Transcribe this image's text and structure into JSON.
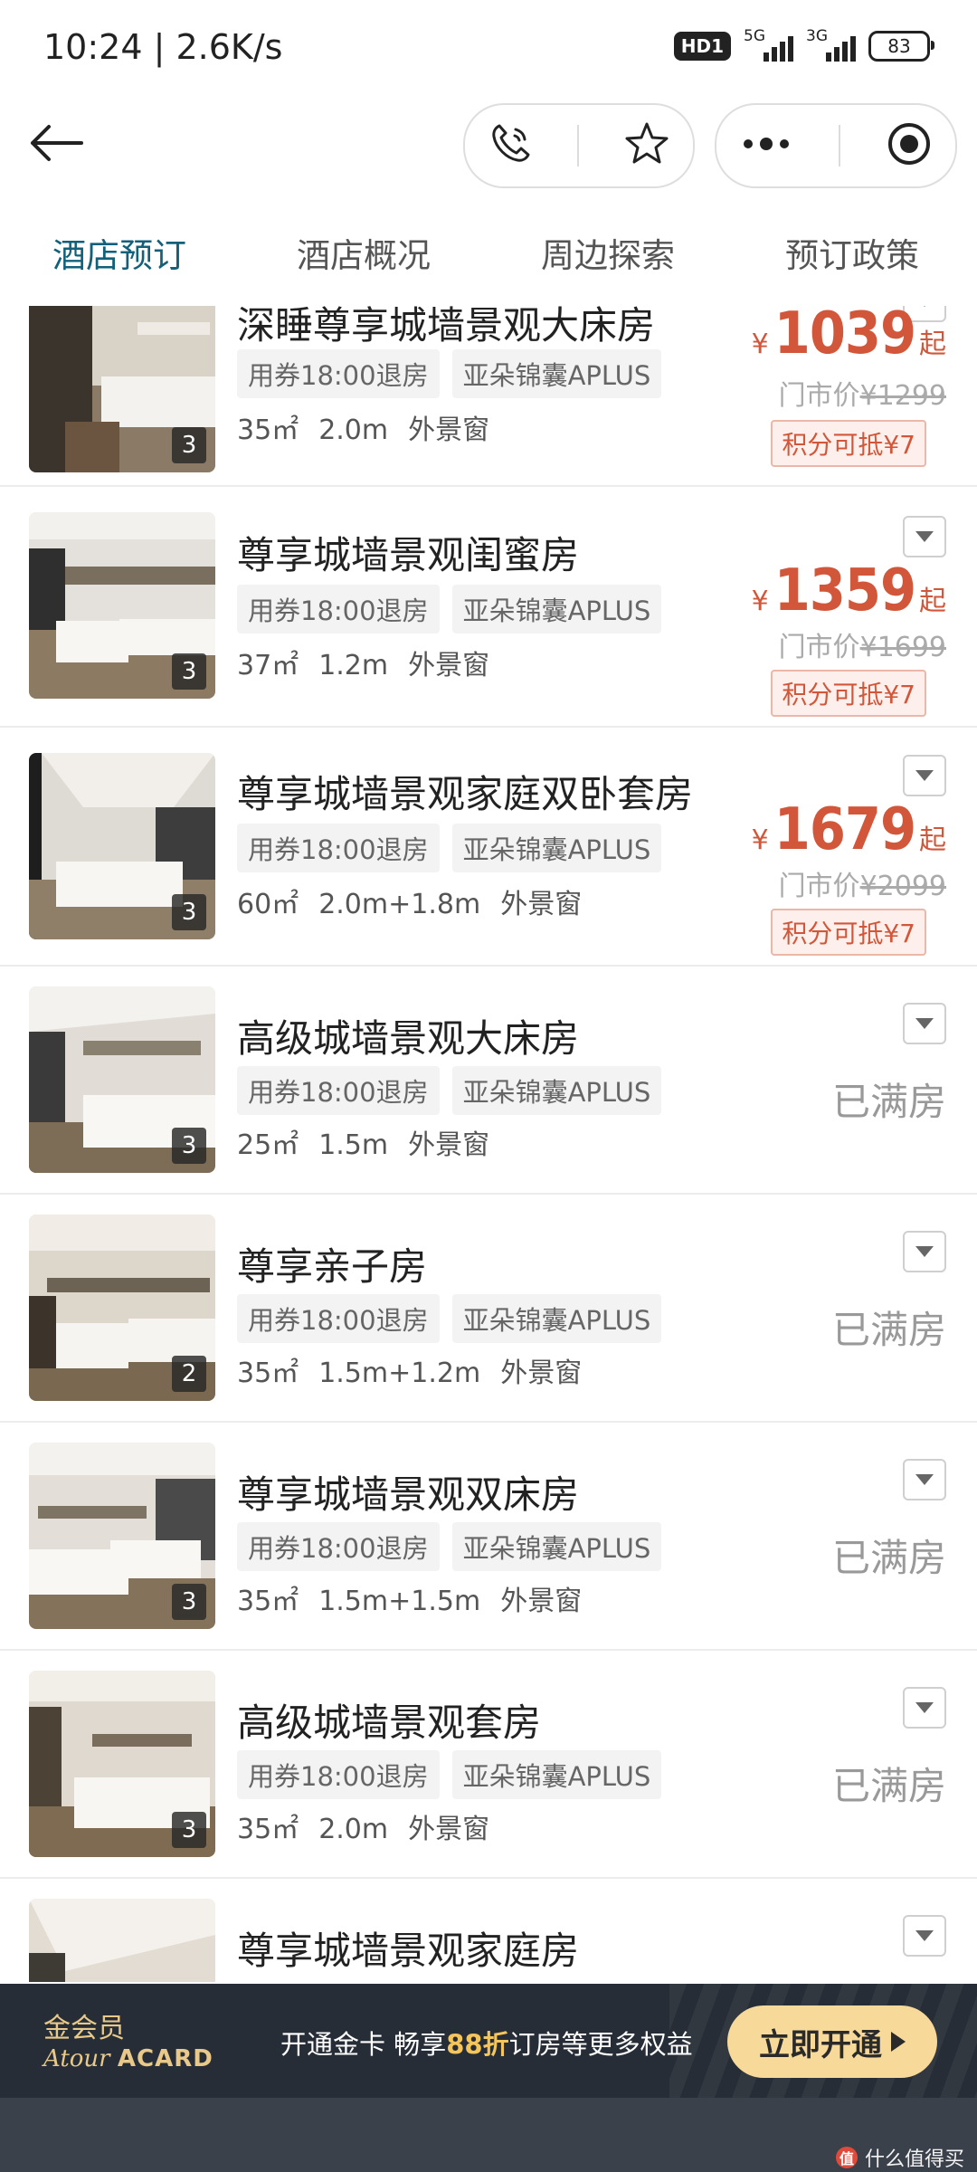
{
  "status": {
    "time": "10:24 | 2.6K/s",
    "hd": "HD1",
    "net1": "5G",
    "net2": "3G",
    "battery": "83"
  },
  "header": {
    "icons": [
      "back-arrow-icon",
      "phone-icon",
      "star-icon",
      "more-dots-icon",
      "target-icon"
    ]
  },
  "tabs": [
    "酒店预订",
    "酒店概况",
    "周边探索",
    "预订政策"
  ],
  "rooms": [
    {
      "name": "深睡尊享城墙景观大床房",
      "tags": [
        "用券18:00退房",
        "亚朵锦囊APLUS"
      ],
      "area": "35㎡",
      "bed": "2.0m",
      "window": "外景窗",
      "photos": "3",
      "yen": "¥",
      "price": "1039",
      "price_suffix": "起",
      "market_label": "门市价",
      "market_price": "¥1299",
      "points": "积分可抵¥7"
    },
    {
      "name": "尊享城墙景观闺蜜房",
      "tags": [
        "用券18:00退房",
        "亚朵锦囊APLUS"
      ],
      "area": "37㎡",
      "bed": "1.2m",
      "window": "外景窗",
      "photos": "3",
      "yen": "¥",
      "price": "1359",
      "price_suffix": "起",
      "market_label": "门市价",
      "market_price": "¥1699",
      "points": "积分可抵¥7"
    },
    {
      "name": "尊享城墙景观家庭双卧套房",
      "tags": [
        "用券18:00退房",
        "亚朵锦囊APLUS"
      ],
      "area": "60㎡",
      "bed": "2.0m+1.8m",
      "window": "外景窗",
      "photos": "3",
      "yen": "¥",
      "price": "1679",
      "price_suffix": "起",
      "market_label": "门市价",
      "market_price": "¥2099",
      "points": "积分可抵¥7"
    },
    {
      "name": "高级城墙景观大床房",
      "tags": [
        "用券18:00退房",
        "亚朵锦囊APLUS"
      ],
      "area": "25㎡",
      "bed": "1.5m",
      "window": "外景窗",
      "photos": "3",
      "status": "已满房"
    },
    {
      "name": "尊享亲子房",
      "tags": [
        "用券18:00退房",
        "亚朵锦囊APLUS"
      ],
      "area": "35㎡",
      "bed": "1.5m+1.2m",
      "window": "外景窗",
      "photos": "2",
      "status": "已满房"
    },
    {
      "name": "尊享城墙景观双床房",
      "tags": [
        "用券18:00退房",
        "亚朵锦囊APLUS"
      ],
      "area": "35㎡",
      "bed": "1.5m+1.5m",
      "window": "外景窗",
      "photos": "3",
      "status": "已满房"
    },
    {
      "name": "高级城墙景观套房",
      "tags": [
        "用券18:00退房",
        "亚朵锦囊APLUS"
      ],
      "area": "35㎡",
      "bed": "2.0m",
      "window": "外景窗",
      "photos": "3",
      "status": "已满房"
    },
    {
      "name": "尊享城墙景观家庭房"
    }
  ],
  "member": {
    "title": "金会员",
    "brand_script": "Atour",
    "brand_card": "ACARD",
    "promo_pre": "开通金卡 畅享",
    "promo_highlight": "88折",
    "promo_post": "订房等更多权益",
    "button": "立即开通"
  },
  "watermark": {
    "icon": "值",
    "text": "什么值得买"
  }
}
